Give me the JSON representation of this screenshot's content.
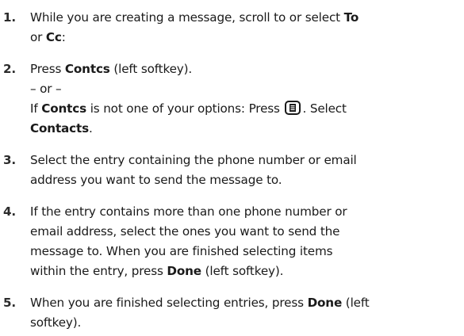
{
  "steps": [
    {
      "number": "1.",
      "line1_a": "While you are creating a message, scroll to or select ",
      "line1_bold_a": "To",
      "line2_a": "or ",
      "line2_bold_a": "Cc",
      "line2_b": ":"
    },
    {
      "number": "2.",
      "line1_a": "Press ",
      "line1_bold_a": "Contcs",
      "line1_b": " (left softkey).",
      "line2": "– or –",
      "line3_a": "If ",
      "line3_bold_a": "Contcs",
      "line3_b": " is not one of your options: Press ",
      "line3_c": ". Select",
      "line4_bold": "Contacts",
      "line4_b": "."
    },
    {
      "number": "3.",
      "line1": "Select the entry containing the phone number or email",
      "line2": "address you want to send the message to."
    },
    {
      "number": "4.",
      "line1": "If the entry contains more than one phone number or",
      "line2": "email address, select the ones you want to send the",
      "line3": "message to. When you are finished selecting items",
      "line4_a": "within the entry, press ",
      "line4_bold": "Done",
      "line4_b": " (left softkey)."
    },
    {
      "number": "5.",
      "line1_a": "When you are finished selecting entries, press ",
      "line1_bold": "Done",
      "line1_b": " (left",
      "line2": "softkey)."
    }
  ],
  "icons": {
    "menu_key": "menu-key-icon"
  }
}
